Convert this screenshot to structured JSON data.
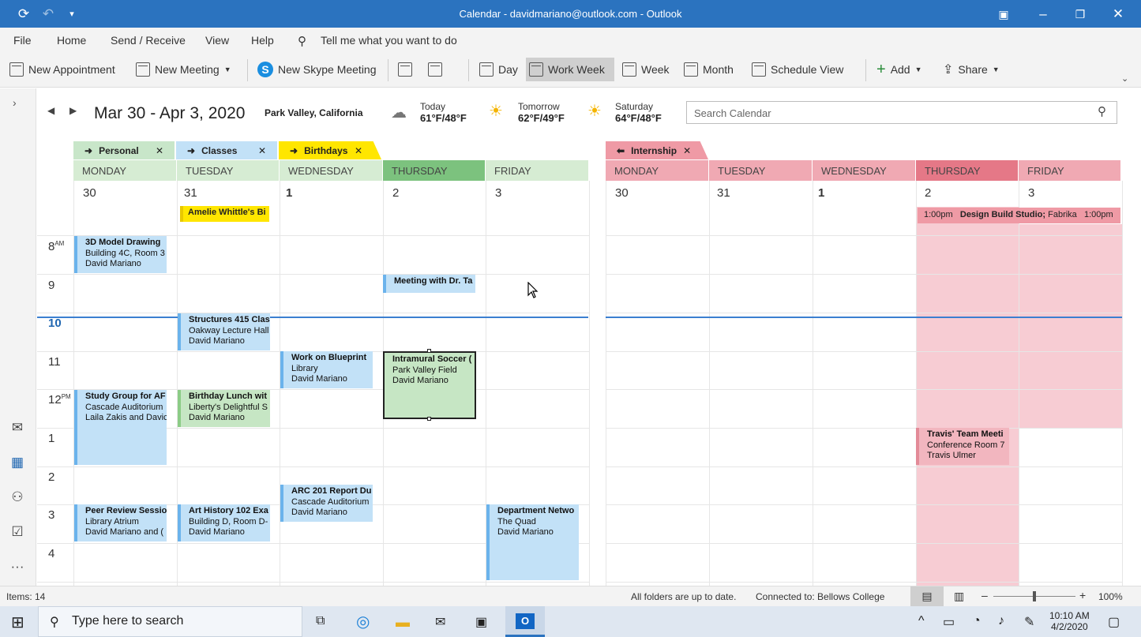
{
  "window": {
    "title": "Calendar - davidmariano@outlook.com - Outlook"
  },
  "menu": [
    "File",
    "Home",
    "Send / Receive",
    "View",
    "Help",
    "Tell me what you want to do"
  ],
  "ribbon": {
    "new_appointment": "New Appointment",
    "new_meeting": "New Meeting",
    "new_skype": "New Skype Meeting",
    "day": "Day",
    "work_week": "Work Week",
    "week": "Week",
    "month": "Month",
    "schedule_view": "Schedule View",
    "add": "Add",
    "share": "Share"
  },
  "nav": {
    "date_range": "Mar 30 - Apr 3, 2020",
    "location": "Park Valley, California"
  },
  "weather": [
    {
      "label": "Today",
      "temp": "61°F/48°F"
    },
    {
      "label": "Tomorrow",
      "temp": "62°F/49°F"
    },
    {
      "label": "Saturday",
      "temp": "64°F/48°F"
    }
  ],
  "search": {
    "placeholder": "Search Calendar"
  },
  "calendars_left": [
    {
      "name": "Personal",
      "color": "#c8e6c9"
    },
    {
      "name": "Classes",
      "color": "#c2e1f7"
    },
    {
      "name": "Birthdays",
      "color": "#ffe600"
    }
  ],
  "calendar_right": {
    "name": "Internship",
    "color": "#ef9aa5"
  },
  "days": [
    {
      "name": "MONDAY",
      "date": "30"
    },
    {
      "name": "TUESDAY",
      "date": "31"
    },
    {
      "name": "WEDNESDAY",
      "date": "1"
    },
    {
      "name": "THURSDAY",
      "date": "2"
    },
    {
      "name": "FRIDAY",
      "date": "3"
    }
  ],
  "hours": {
    "h8": "8",
    "h8s": "AM",
    "h9": "9",
    "h10": "10",
    "h11": "11",
    "h12": "12",
    "h12s": "PM",
    "h1": "1",
    "h2": "2",
    "h3": "3",
    "h4": "4"
  },
  "allday": {
    "birthday": "Amelie Whittle's Bi",
    "design_time": "1:00pm",
    "design_title": "Design Build Studio;",
    "design_loc": "Fabrika",
    "design_time2": "1:00pm"
  },
  "events": {
    "e1": {
      "t": "3D Model Drawing",
      "l": "Building 4C, Room 3",
      "o": "David Mariano"
    },
    "e2": {
      "t": "Meeting with Dr. Ta",
      "l": "",
      "o": ""
    },
    "e3": {
      "t": "Structures 415 Clas",
      "l": "Oakway Lecture Hall",
      "o": "David Mariano"
    },
    "e4": {
      "t": "Work on Blueprint",
      "l": "Library",
      "o": "David Mariano"
    },
    "e5": {
      "t": "Intramural Soccer (",
      "l": "Park Valley Field",
      "o": "David Mariano"
    },
    "e6": {
      "t": "Study Group for AF",
      "l": "Cascade Auditorium",
      "o": "Laila Zakis and Davic"
    },
    "e7": {
      "t": "Birthday Lunch wit",
      "l": "Liberty's Delightful S",
      "o": "David Mariano"
    },
    "e8": {
      "t": "ARC 201 Report Du",
      "l": "Cascade Auditorium",
      "o": "David Mariano"
    },
    "e9": {
      "t": "Peer Review Sessio",
      "l": "Library Atrium",
      "o": "David Mariano and ("
    },
    "e10": {
      "t": "Art History 102 Exa",
      "l": "Building D, Room D-",
      "o": "David Mariano"
    },
    "e11": {
      "t": "Department Netwo",
      "l": "The Quad",
      "o": "David Mariano"
    },
    "e12": {
      "t": "Travis' Team Meeti",
      "l": "Conference Room 7",
      "o": "Travis Ulmer"
    }
  },
  "status": {
    "items": "Items: 14",
    "sync": "All folders are up to date.",
    "connected": "Connected to: Bellows College",
    "zoom": "100%"
  },
  "taskbar": {
    "search": "Type here to search",
    "time": "10:10 AM",
    "date": "4/2/2020"
  }
}
